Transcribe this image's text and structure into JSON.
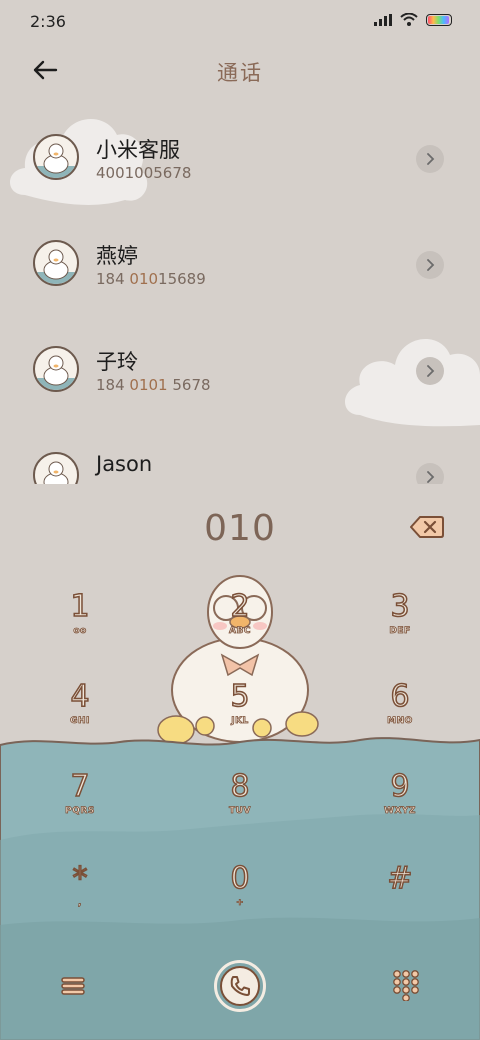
{
  "status_bar": {
    "time": "2:36"
  },
  "header": {
    "title": "通话"
  },
  "contacts": [
    {
      "name": "小米客服",
      "number_pre": "",
      "number_hl": "",
      "number_post": "4001005678"
    },
    {
      "name": "燕婷",
      "number_pre": "184 ",
      "number_hl": "010",
      "number_post": "15689"
    },
    {
      "name": "子玲",
      "number_pre": "184 ",
      "number_hl": "0101",
      "number_post": " 5678"
    },
    {
      "name": "Jason",
      "number_pre": "",
      "number_hl": "",
      "number_post": ""
    }
  ],
  "dialer": {
    "number": "010"
  },
  "keypad": {
    "keys": [
      {
        "digit": "1",
        "letters": "oo"
      },
      {
        "digit": "2",
        "letters": "ABC"
      },
      {
        "digit": "3",
        "letters": "DEF"
      },
      {
        "digit": "4",
        "letters": "GHI"
      },
      {
        "digit": "5",
        "letters": "JKL"
      },
      {
        "digit": "6",
        "letters": "MNO"
      },
      {
        "digit": "7",
        "letters": "PQRS"
      },
      {
        "digit": "8",
        "letters": "TUV"
      },
      {
        "digit": "9",
        "letters": "WXYZ"
      },
      {
        "digit": "*",
        "letters": ","
      },
      {
        "digit": "0",
        "letters": "+"
      },
      {
        "digit": "#",
        "letters": ""
      }
    ]
  },
  "colors": {
    "background": "#d6d0cb",
    "title": "#8a6a58",
    "dial_number": "#7d6557",
    "water": "#8fb5b9",
    "key_outline": "#7a4f37"
  },
  "icons": {
    "back": "arrow-left-icon",
    "chevron": "chevron-right-icon",
    "delete": "backspace-icon",
    "menu": "menu-icon",
    "call": "phone-icon",
    "keypad": "dialpad-icon"
  }
}
